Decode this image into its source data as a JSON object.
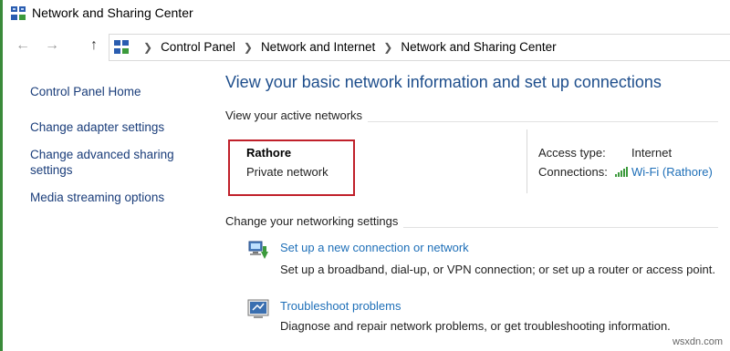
{
  "window": {
    "title": "Network and Sharing Center"
  },
  "nav": {
    "back_icon": "back-arrow-icon",
    "forward_icon": "forward-arrow-icon",
    "up_icon": "up-arrow-icon",
    "breadcrumbs": [
      "Control Panel",
      "Network and Internet",
      "Network and Sharing Center"
    ]
  },
  "sidebar": {
    "items": [
      {
        "label": "Control Panel Home"
      },
      {
        "label": "Change adapter settings"
      },
      {
        "label": "Change advanced sharing settings"
      },
      {
        "label": "Media streaming options"
      }
    ]
  },
  "main": {
    "title": "View your basic network information and set up connections",
    "active_networks_label": "View your active networks",
    "network": {
      "name": "Rathore",
      "type": "Private network",
      "access_type_label": "Access type:",
      "access_type_value": "Internet",
      "connections_label": "Connections:",
      "connection_value": "Wi-Fi (Rathore)"
    },
    "change_settings_label": "Change your networking settings",
    "tasks": [
      {
        "link": "Set up a new connection or network",
        "description": "Set up a broadband, dial-up, or VPN connection; or set up a router or access point."
      },
      {
        "link": "Troubleshoot problems",
        "description": "Diagnose and repair network problems, or get troubleshooting information."
      }
    ]
  },
  "watermark": "wsxdn.com",
  "colors": {
    "link": "#1e6fb8",
    "title": "#1e4e8c",
    "highlight_box": "#c0202a",
    "edge": "#3a8a3a"
  }
}
